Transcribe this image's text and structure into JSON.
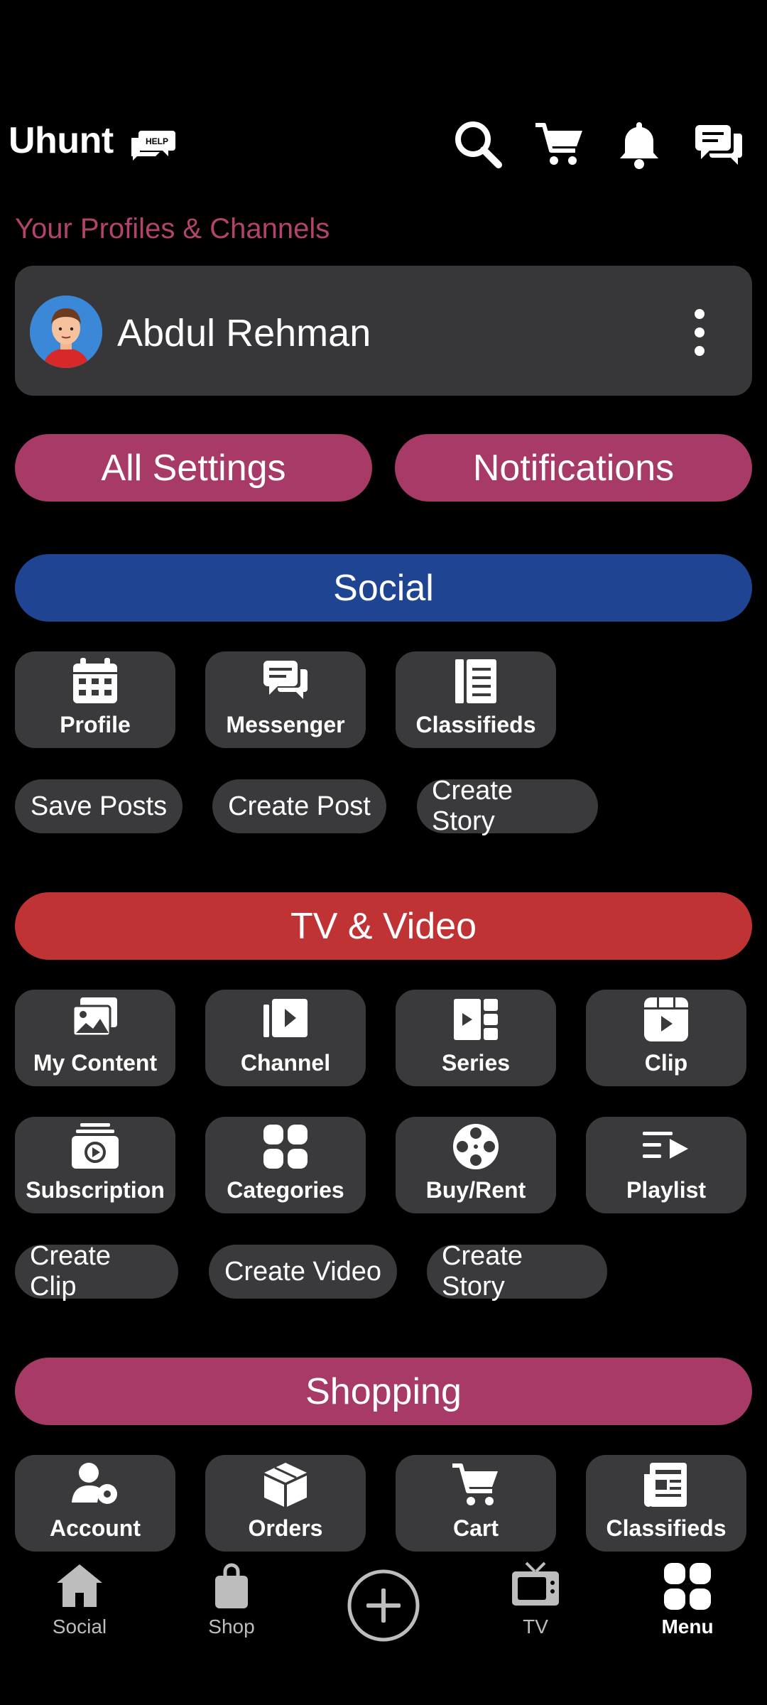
{
  "header": {
    "app_title": "Uhunt",
    "help_badge": "HELP",
    "icons": [
      "search-icon",
      "cart-icon",
      "bell-icon",
      "chat-icon"
    ]
  },
  "profiles": {
    "section_label": "Your Profiles & Channels",
    "name": "Abdul Rehman"
  },
  "actions": {
    "all_settings": "All Settings",
    "notifications": "Notifications"
  },
  "social": {
    "title": "Social",
    "tiles": [
      {
        "label": "Profile",
        "icon": "calendar-icon"
      },
      {
        "label": "Messenger",
        "icon": "messenger-icon"
      },
      {
        "label": "Classifieds",
        "icon": "list-icon"
      }
    ],
    "chips": [
      "Save Posts",
      "Create Post",
      "Create Story"
    ]
  },
  "tv": {
    "title": "TV & Video",
    "tiles": [
      {
        "label": "My Content",
        "icon": "image-icon"
      },
      {
        "label": "Channel",
        "icon": "channel-icon"
      },
      {
        "label": "Series",
        "icon": "series-icon"
      },
      {
        "label": "Clip",
        "icon": "clip-icon"
      },
      {
        "label": "Subscription",
        "icon": "subscription-icon"
      },
      {
        "label": "Categories",
        "icon": "categories-icon"
      },
      {
        "label": "Buy/Rent",
        "icon": "film-reel-icon"
      },
      {
        "label": "Playlist",
        "icon": "playlist-icon"
      }
    ],
    "chips": [
      "Create Clip",
      "Create Video",
      "Create Story"
    ]
  },
  "shopping": {
    "title": "Shopping",
    "tiles": [
      {
        "label": "Account",
        "icon": "account-settings-icon"
      },
      {
        "label": "Orders",
        "icon": "box-icon"
      },
      {
        "label": "Cart",
        "icon": "cart-icon"
      },
      {
        "label": "Classifieds",
        "icon": "newspaper-icon"
      }
    ]
  },
  "nav": {
    "items": [
      {
        "label": "Social",
        "icon": "home-icon"
      },
      {
        "label": "Shop",
        "icon": "bag-icon"
      },
      {
        "label": "",
        "icon": "add-circle-icon"
      },
      {
        "label": "TV",
        "icon": "tv-icon"
      },
      {
        "label": "Menu",
        "icon": "grid-icon",
        "active": true
      }
    ]
  },
  "colors": {
    "accent_pink": "#a73a66",
    "social_blue": "#1f4592",
    "tv_red": "#c03335",
    "tile_bg": "#3a3a3c"
  }
}
